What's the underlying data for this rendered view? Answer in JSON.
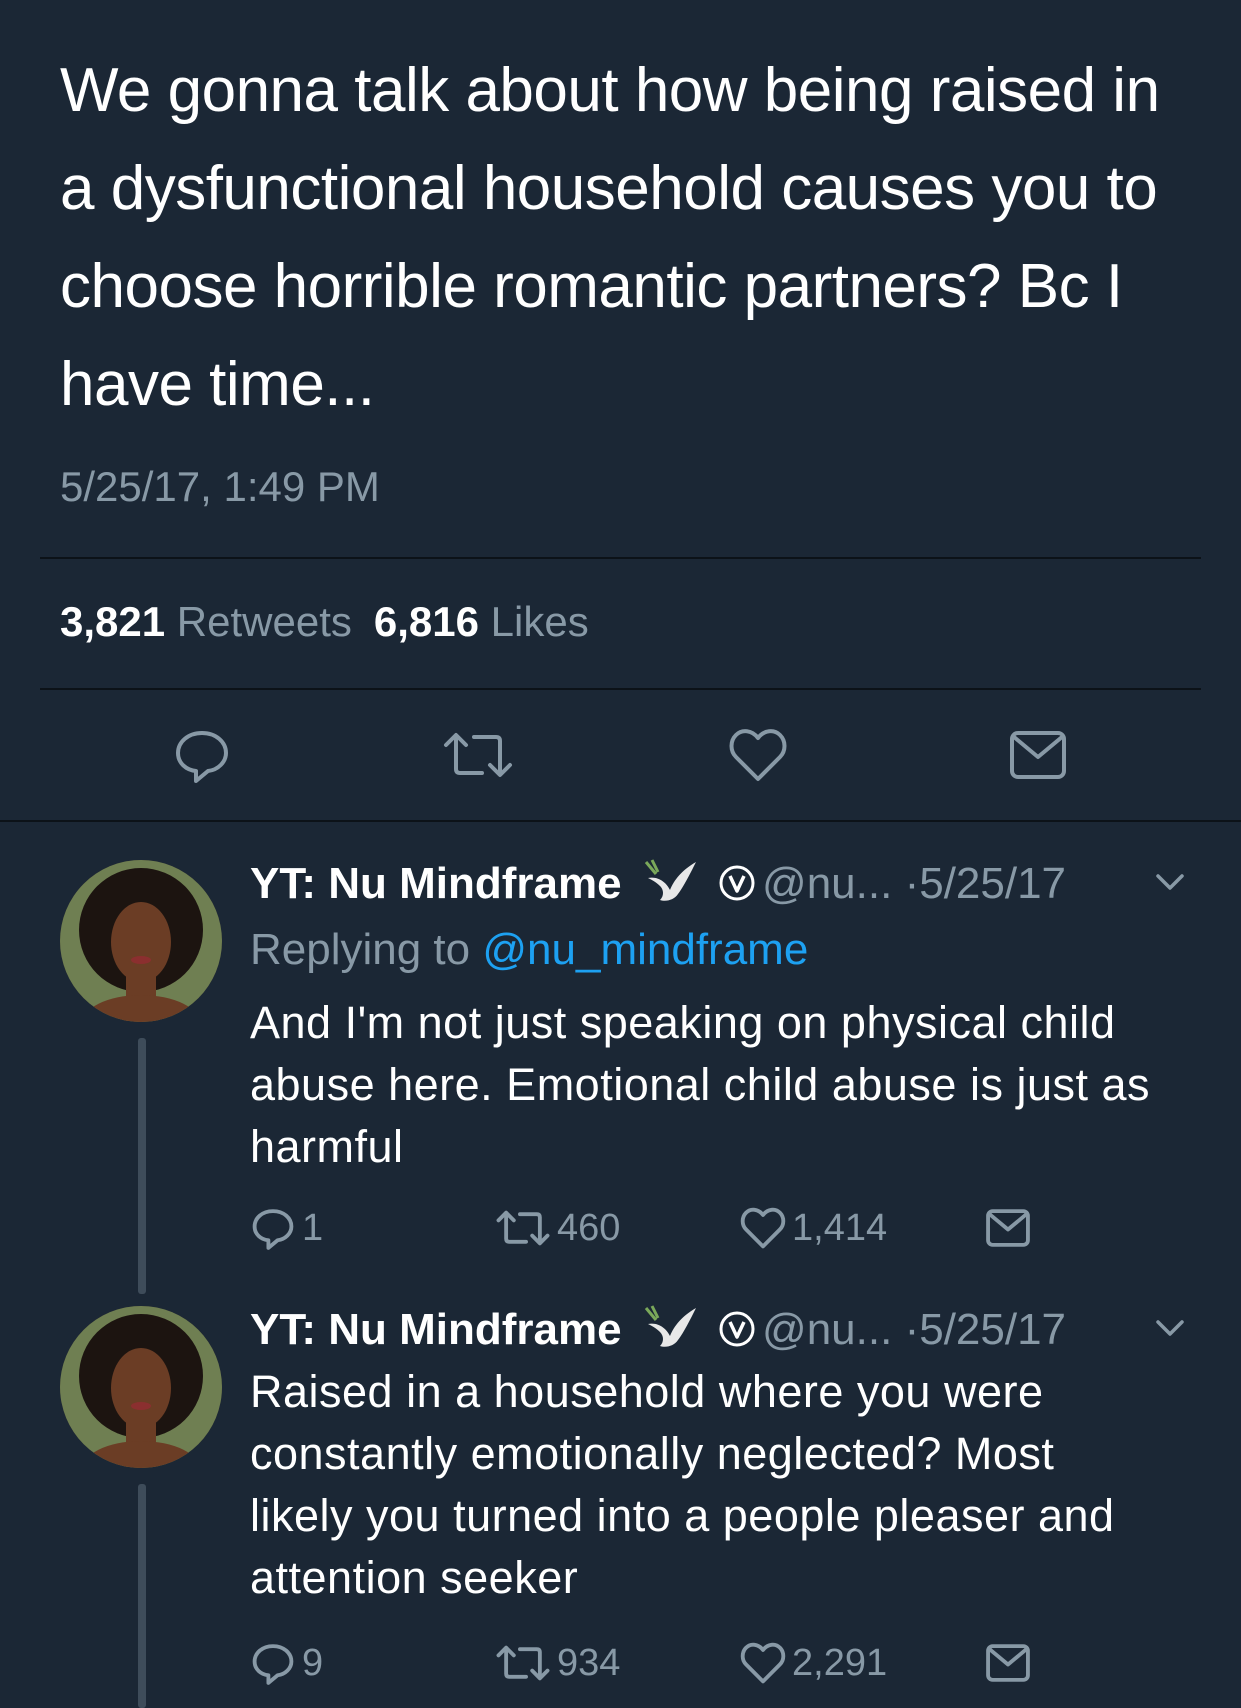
{
  "tweet": {
    "text": "We gonna talk about how being raised in a dysfunctional household causes you to choose horrible romantic partners? Bc I have time...",
    "timestamp": "5/25/17, 1:49 PM",
    "retweets_count": "3,821",
    "retweets_label": "Retweets",
    "likes_count": "6,816",
    "likes_label": "Likes"
  },
  "action_icons": [
    "reply-icon",
    "retweet-icon",
    "like-icon",
    "message-icon"
  ],
  "colors": {
    "background": "#1b2735",
    "secondary_text": "#8899a6",
    "link": "#1da1f2",
    "divider": "#0c1218"
  },
  "replies": [
    {
      "author_name": "YT: Nu Mindframe",
      "handle": "@nu...",
      "separator": "·",
      "date": "5/25/17",
      "replying_label": "Replying to",
      "replying_handle": "@nu_mindframe",
      "text": "And I'm not just speaking on physical child abuse here. Emotional child abuse is just as harmful",
      "reply_count": "1",
      "retweet_count": "460",
      "like_count": "1,414"
    },
    {
      "author_name": "YT: Nu Mindframe",
      "handle": "@nu...",
      "separator": "·",
      "date": "5/25/17",
      "text": "Raised in a household where you were constantly emotionally neglected? Most likely you turned into a people pleaser and attention seeker",
      "reply_count": "9",
      "retweet_count": "934",
      "like_count": "2,291"
    }
  ]
}
